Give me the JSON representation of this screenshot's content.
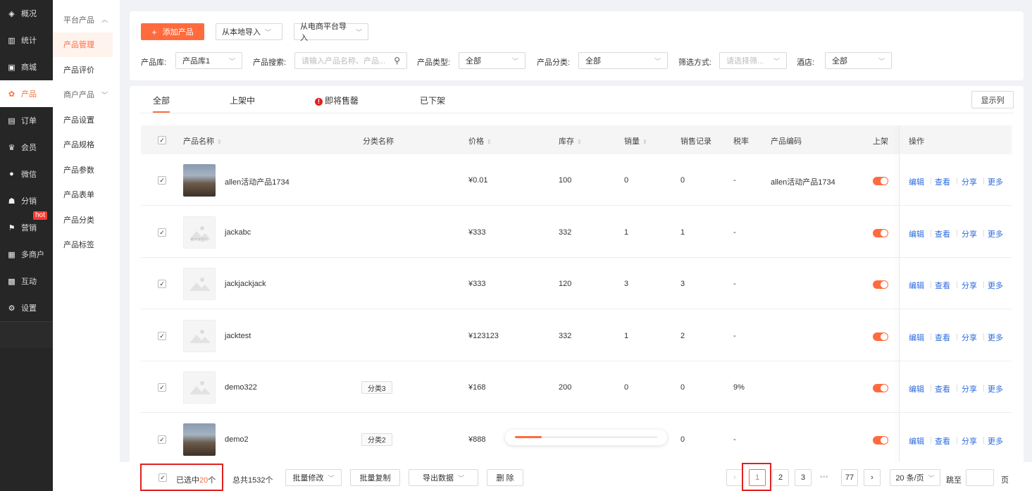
{
  "sidebar": {
    "items": [
      {
        "label": "概况",
        "icon": "layers-icon",
        "glyph": "◈"
      },
      {
        "label": "统计",
        "icon": "chart-icon",
        "glyph": "▥"
      },
      {
        "label": "商城",
        "icon": "store-icon",
        "glyph": "▣"
      },
      {
        "label": "产品",
        "icon": "apps-icon",
        "glyph": "✿",
        "active": true
      },
      {
        "label": "订单",
        "icon": "order-icon",
        "glyph": "▤"
      },
      {
        "label": "会员",
        "icon": "crown-icon",
        "glyph": "♛"
      },
      {
        "label": "微信",
        "icon": "wechat-icon",
        "glyph": "●"
      },
      {
        "label": "分销",
        "icon": "distribution-icon",
        "glyph": "☗"
      },
      {
        "label": "营销",
        "icon": "flag-icon",
        "glyph": "⚑",
        "badge": "hot"
      },
      {
        "label": "多商户",
        "icon": "merchant-icon",
        "glyph": "▦"
      },
      {
        "label": "互动",
        "icon": "interaction-icon",
        "glyph": "▩"
      },
      {
        "label": "设置",
        "icon": "gear-icon",
        "glyph": "⚙"
      }
    ]
  },
  "subnav": {
    "items": [
      {
        "label": "平台产品",
        "group": true,
        "chev": "︿"
      },
      {
        "label": "产品管理",
        "active": true
      },
      {
        "label": "产品评价"
      },
      {
        "label": "商户产品",
        "group": true,
        "chev": "﹀"
      },
      {
        "label": "产品设置"
      },
      {
        "label": "产品规格"
      },
      {
        "label": "产品参数"
      },
      {
        "label": "产品表单"
      },
      {
        "label": "产品分类"
      },
      {
        "label": "产品标签"
      }
    ]
  },
  "toolbar": {
    "add_label": "添加产品",
    "import_local": "从本地导入",
    "import_ecom": "从电商平台导入"
  },
  "filters": {
    "library_label": "产品库:",
    "library_value": "产品库1",
    "search_label": "产品搜索:",
    "search_placeholder": "请输入产品名称、产品...",
    "type_label": "产品类型:",
    "type_value": "全部",
    "category_label": "产品分类:",
    "category_value": "全部",
    "filter_label": "筛选方式:",
    "filter_placeholder": "请选择筛...",
    "hotel_label": "酒店:",
    "hotel_value": "全部"
  },
  "tabs": [
    "全部",
    "上架中",
    "即将售罄",
    "已下架"
  ],
  "columns_button": "显示列",
  "table": {
    "headers": {
      "name": "产品名称",
      "category": "分类名称",
      "price": "价格",
      "stock": "库存",
      "sales": "销量",
      "records": "销售记录",
      "tax": "税率",
      "code": "产品编码",
      "shelf": "上架",
      "ops": "操作"
    },
    "ops": [
      "编辑",
      "查看",
      "分享",
      "更多"
    ],
    "rows": [
      {
        "name": "allen活动产品1734",
        "category": "",
        "price": "¥0.01",
        "stock": "100",
        "sales": "0",
        "records": "0",
        "tax": "-",
        "code": "allen活动产品1734",
        "thumb": "photo"
      },
      {
        "name": "jackabc",
        "category": "",
        "price": "¥333",
        "stock": "332",
        "sales": "1",
        "records": "1",
        "tax": "-",
        "code": "",
        "thumb": "placeholder-text",
        "thumb_text": "推不到图片"
      },
      {
        "name": "jackjackjack",
        "category": "",
        "price": "¥333",
        "stock": "120",
        "sales": "3",
        "records": "3",
        "tax": "-",
        "code": "",
        "thumb": "placeholder"
      },
      {
        "name": "jacktest",
        "category": "",
        "price": "¥123123",
        "stock": "332",
        "sales": "1",
        "records": "2",
        "tax": "-",
        "code": "",
        "thumb": "placeholder"
      },
      {
        "name": "demo322",
        "category": "分类3",
        "price": "¥168",
        "stock": "200",
        "sales": "0",
        "records": "0",
        "tax": "9%",
        "code": "",
        "thumb": "placeholder"
      },
      {
        "name": "demo2",
        "category": "分类2",
        "price": "¥888",
        "stock": "",
        "sales": "",
        "records": "0",
        "tax": "-",
        "code": "",
        "thumb": "photo"
      }
    ]
  },
  "loading_progress": 0.19,
  "bottom": {
    "selected_prefix": "已选中",
    "selected_count": "20",
    "selected_suffix": "个",
    "total": "总共1532个",
    "batch_edit": "批量修改",
    "batch_copy": "批量复制",
    "export": "导出数据",
    "delete": "删 除"
  },
  "pagination": {
    "prev": "‹",
    "next": "›",
    "pages": [
      "1",
      "2",
      "3"
    ],
    "ellipsis": "•••",
    "last": "77",
    "page_size": "20 条/页",
    "jump_label": "跳至",
    "page_suffix": "页"
  },
  "colors": {
    "accent": "#ff6b3d",
    "link": "#2d6cdf",
    "highlight": "#e02020"
  }
}
